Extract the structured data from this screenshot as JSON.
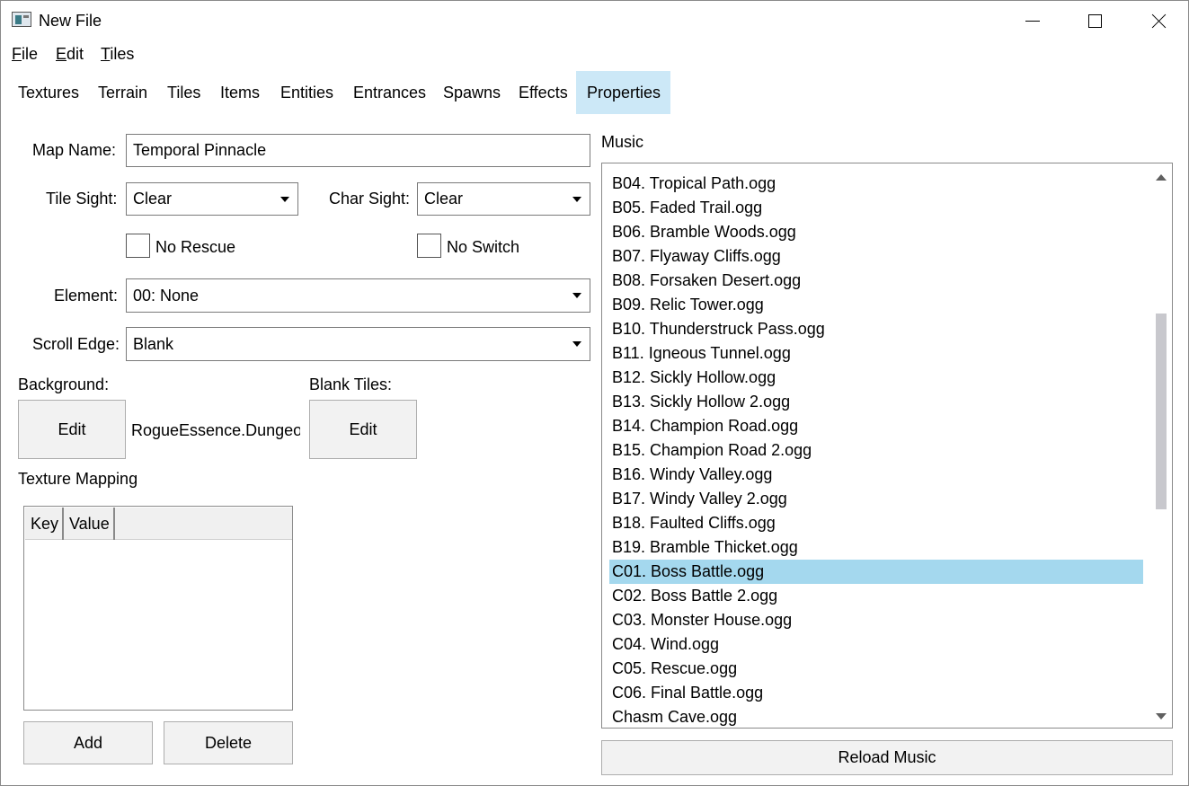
{
  "window": {
    "title": "New File",
    "controls": {
      "minimize": "minimize",
      "maximize": "maximize",
      "close": "close"
    }
  },
  "menu": [
    {
      "underline": "F",
      "rest": "ile"
    },
    {
      "underline": "E",
      "rest": "dit"
    },
    {
      "underline": "T",
      "rest": "iles"
    }
  ],
  "tabs": [
    "Textures",
    "Terrain",
    "Tiles",
    "Items",
    "Entities",
    "Entrances",
    "Spawns",
    "Effects",
    "Properties"
  ],
  "active_tab": "Properties",
  "properties": {
    "map_name_label": "Map Name:",
    "map_name_value": "Temporal Pinnacle",
    "tile_sight_label": "Tile Sight:",
    "tile_sight_value": "Clear",
    "char_sight_label": "Char Sight:",
    "char_sight_value": "Clear",
    "no_rescue_label": "No Rescue",
    "no_rescue_checked": false,
    "no_switch_label": "No Switch",
    "no_switch_checked": false,
    "element_label": "Element:",
    "element_value": "00: None",
    "scroll_edge_label": "Scroll Edge:",
    "scroll_edge_value": "Blank",
    "background_label": "Background:",
    "background_edit": "Edit",
    "background_value": "RogueEssence.Dungeor",
    "blank_tiles_label": "Blank Tiles:",
    "blank_tiles_edit": "Edit",
    "texture_mapping_label": "Texture Mapping",
    "grid_columns": [
      "Key",
      "Value"
    ],
    "add_button": "Add",
    "delete_button": "Delete"
  },
  "music": {
    "label": "Music",
    "items": [
      "B04. Tropical Path.ogg",
      "B05. Faded Trail.ogg",
      "B06. Bramble Woods.ogg",
      "B07. Flyaway Cliffs.ogg",
      "B08. Forsaken Desert.ogg",
      "B09. Relic Tower.ogg",
      "B10. Thunderstruck Pass.ogg",
      "B11. Igneous Tunnel.ogg",
      "B12. Sickly Hollow.ogg",
      "B13. Sickly Hollow 2.ogg",
      "B14. Champion Road.ogg",
      "B15. Champion Road 2.ogg",
      "B16. Windy Valley.ogg",
      "B17. Windy Valley 2.ogg",
      "B18. Faulted Cliffs.ogg",
      "B19. Bramble Thicket.ogg",
      "C01. Boss Battle.ogg",
      "C02. Boss Battle 2.ogg",
      "C03. Monster House.ogg",
      "C04. Wind.ogg",
      "C05. Rescue.ogg",
      "C06. Final Battle.ogg",
      "Chasm Cave.ogg"
    ],
    "selected": "C01. Boss Battle.ogg",
    "reload_button": "Reload Music"
  },
  "colors": {
    "active_tab": "#cce8f7",
    "selected_item": "#a4d8ee",
    "button_face": "#f2f2f2"
  }
}
